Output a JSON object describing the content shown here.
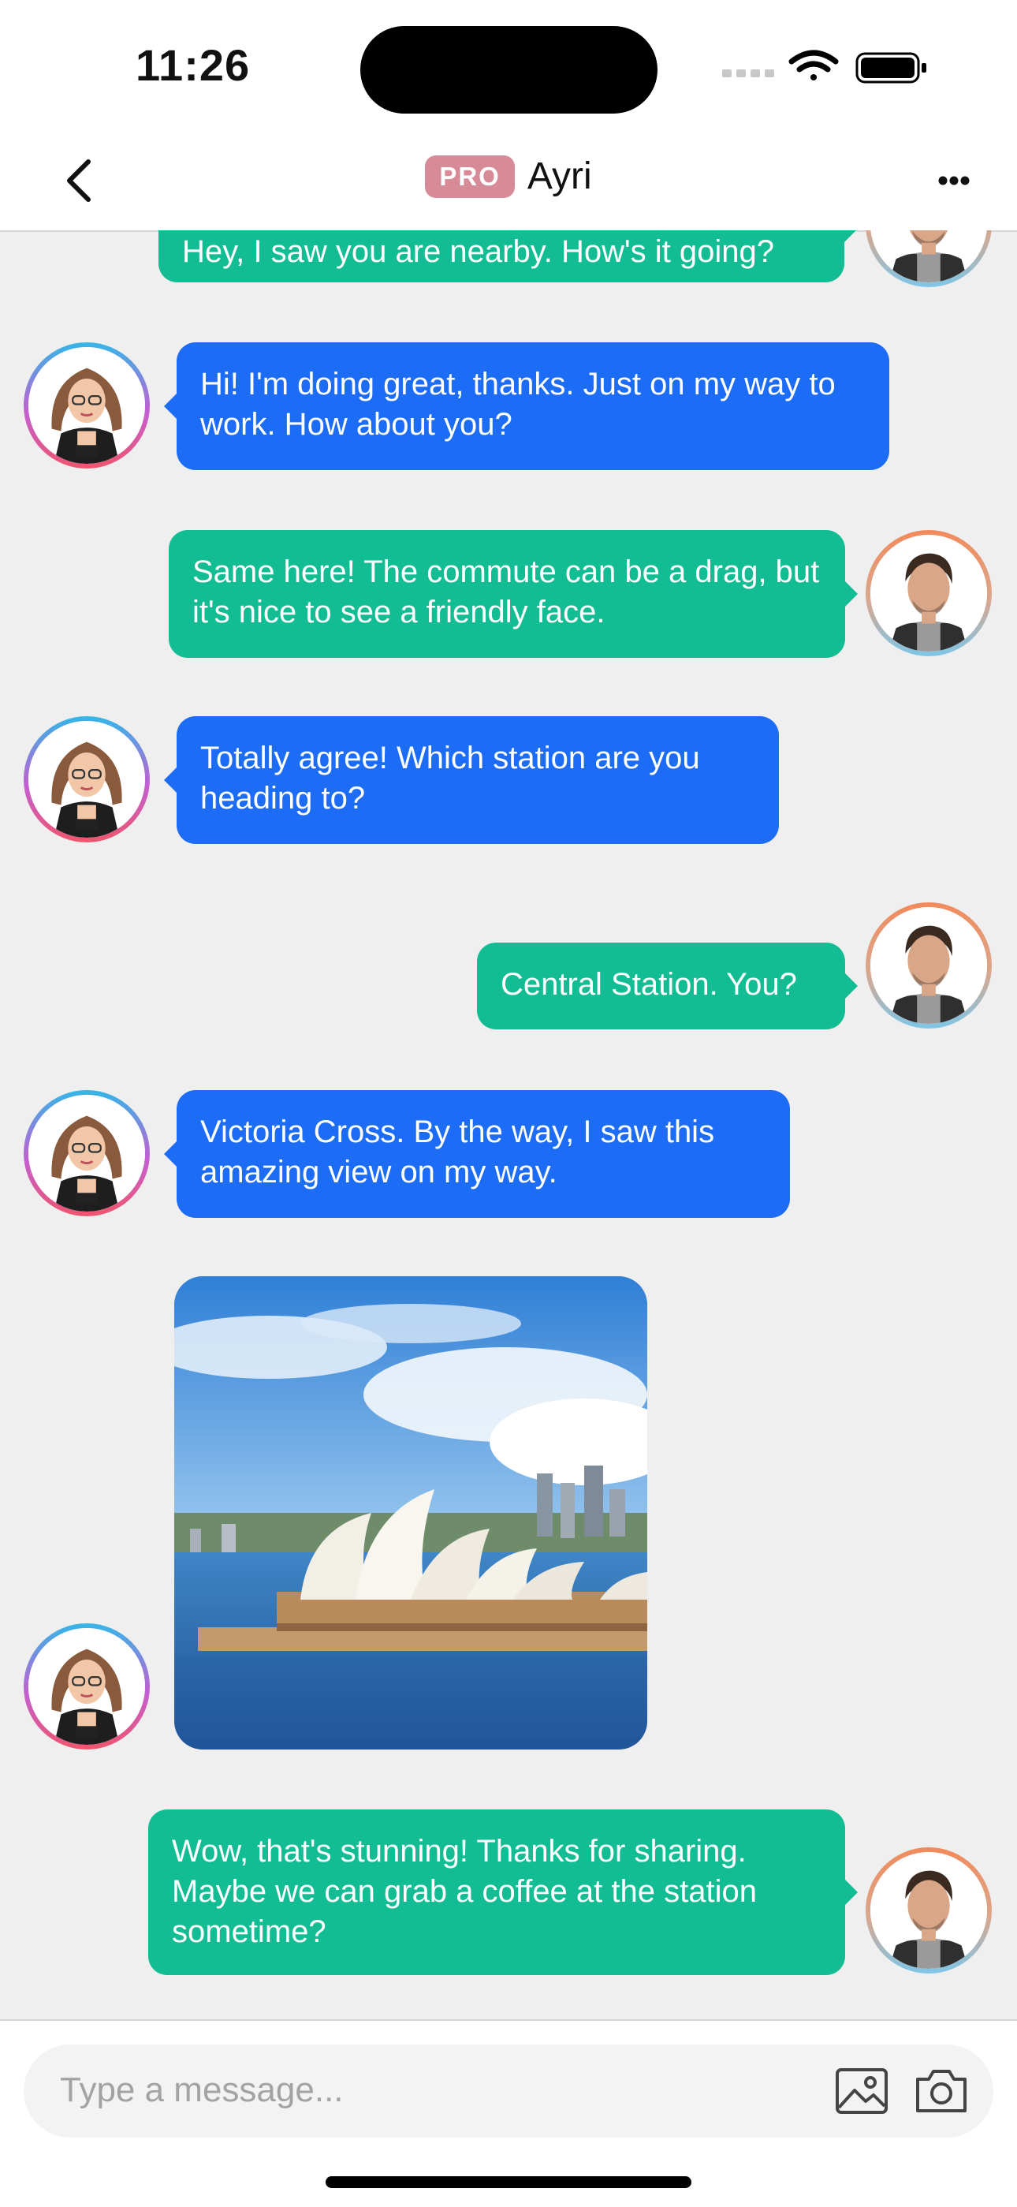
{
  "status_bar": {
    "time": "11:26"
  },
  "header": {
    "badge": "PRO",
    "title": "Ayri"
  },
  "messages": [
    {
      "sender": "me",
      "text": "Hey, I saw you are nearby. How's it going?"
    },
    {
      "sender": "Ayri",
      "text": "Hi! I'm doing great, thanks. Just on my way to work. How about you?"
    },
    {
      "sender": "me",
      "text": "Same here! The commute can be a drag, but it's nice to see a friendly face."
    },
    {
      "sender": "Ayri",
      "text": "Totally agree! Which station are you heading to?"
    },
    {
      "sender": "me",
      "text": "Central Station. You?"
    },
    {
      "sender": "Ayri",
      "text": "Victoria Cross. By the way, I saw this amazing view on my way."
    },
    {
      "sender": "Ayri",
      "type": "image",
      "image": "sydney-opera-house-photo"
    },
    {
      "sender": "me",
      "text": "Wow, that's stunning! Thanks for sharing. Maybe we can grab a coffee at the station sometime?"
    }
  ],
  "composer": {
    "placeholder": "Type a message..."
  },
  "icons": [
    "chevron-left-icon",
    "more-icon",
    "wifi-icon",
    "battery-icon",
    "signal-icon",
    "gallery-icon",
    "camera-icon"
  ],
  "colors": {
    "outgoing_bubble": "#12bd93",
    "incoming_bubble": "#1d6cf5",
    "pro_badge": "#d78b97"
  }
}
